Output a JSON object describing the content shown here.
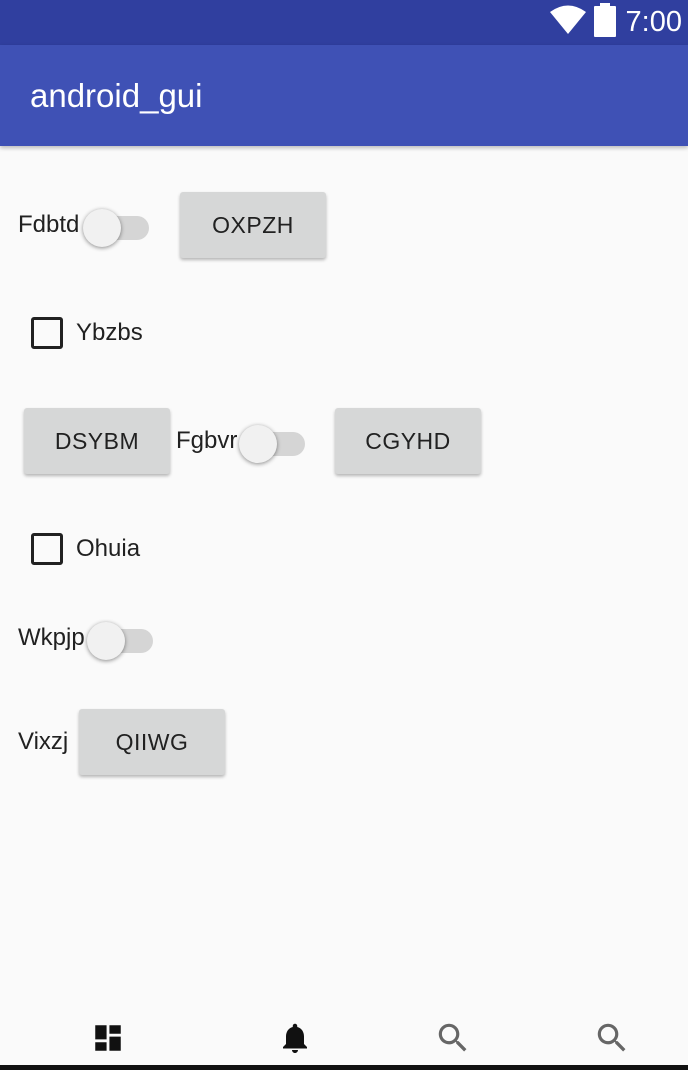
{
  "status_bar": {
    "time": "7:00"
  },
  "app_bar": {
    "title": "android_gui"
  },
  "form": {
    "switch_fdbtd_label": "Fdbtd",
    "button_oxpzh": "OXPZH",
    "checkbox_ybzbs_label": "Ybzbs",
    "button_dsybm": "DSYBM",
    "switch_fgbvr_label": "Fgbvr",
    "button_cgyhd": "CGYHD",
    "checkbox_ohuia_label": "Ohuia",
    "switch_wkpjp_label": "Wkpjp",
    "vixzj_label": "Vixzj",
    "button_qiiwg": "QIIWG"
  },
  "bottom_nav": {
    "items": [
      {
        "icon": "dashboard-icon"
      },
      {
        "icon": "notifications-icon"
      },
      {
        "icon": "search-icon"
      },
      {
        "icon": "search-icon"
      }
    ]
  },
  "colors": {
    "status_bar": "#303f9f",
    "app_bar": "#3f51b5",
    "background": "#fafafa",
    "button": "#d6d7d7"
  }
}
